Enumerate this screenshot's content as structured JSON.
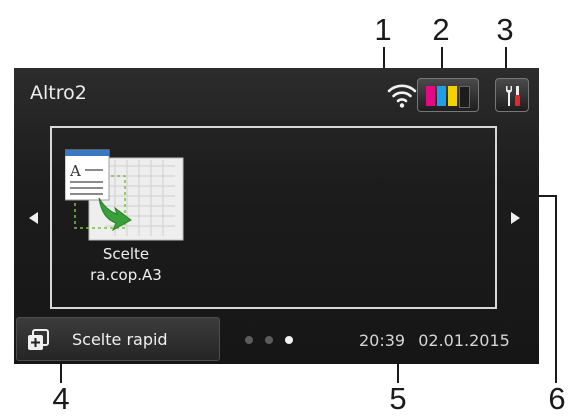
{
  "callouts": [
    "1",
    "2",
    "3",
    "4",
    "5",
    "6"
  ],
  "screen": {
    "title": "Altro2",
    "status_icons": [
      "wifi-signal-icon",
      "ink-cartridge-icon",
      "tools-icon"
    ],
    "ink_colors": [
      "#e40a86",
      "#1da0e8",
      "#f2d200",
      "#1c1c1c"
    ],
    "shortcut": {
      "icon": "a3-copy-shortcut-icon",
      "label_line1": "Scelte",
      "label_line2": "ra.cop.A3"
    },
    "nav": {
      "prev_icon": "arrow-left-icon",
      "next_icon": "arrow-right-icon"
    },
    "quick_button": {
      "icon": "shortcut-plus-icon",
      "label": "Scelte rapid"
    },
    "page_dots": {
      "count": 3,
      "active": 3
    },
    "clock": {
      "time": "20:39",
      "date": "02.01.2015"
    }
  }
}
